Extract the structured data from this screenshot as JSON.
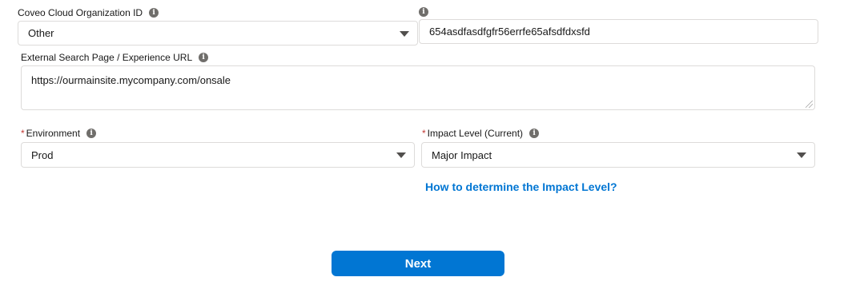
{
  "org_id": {
    "label": "Coveo Cloud Organization ID",
    "selected": "Other",
    "custom_value": "654asdfasdfgfr56errfe65afsdfdxsfd"
  },
  "search_url": {
    "label": "External Search Page / Experience URL",
    "value": "https://ourmainsite.mycompany.com/onsale"
  },
  "environment": {
    "required_mark": "*",
    "label": "Environment",
    "selected": "Prod"
  },
  "impact_level": {
    "required_mark": "*",
    "label": "Impact Level (Current)",
    "selected": "Major Impact",
    "help_link": "How to determine the Impact Level?"
  },
  "actions": {
    "next_label": "Next"
  },
  "icons": {
    "info": "info-icon",
    "dropdown": "chevron-down-icon"
  },
  "colors": {
    "accent": "#0176d3",
    "required": "#c23934",
    "border": "#dddbda"
  }
}
